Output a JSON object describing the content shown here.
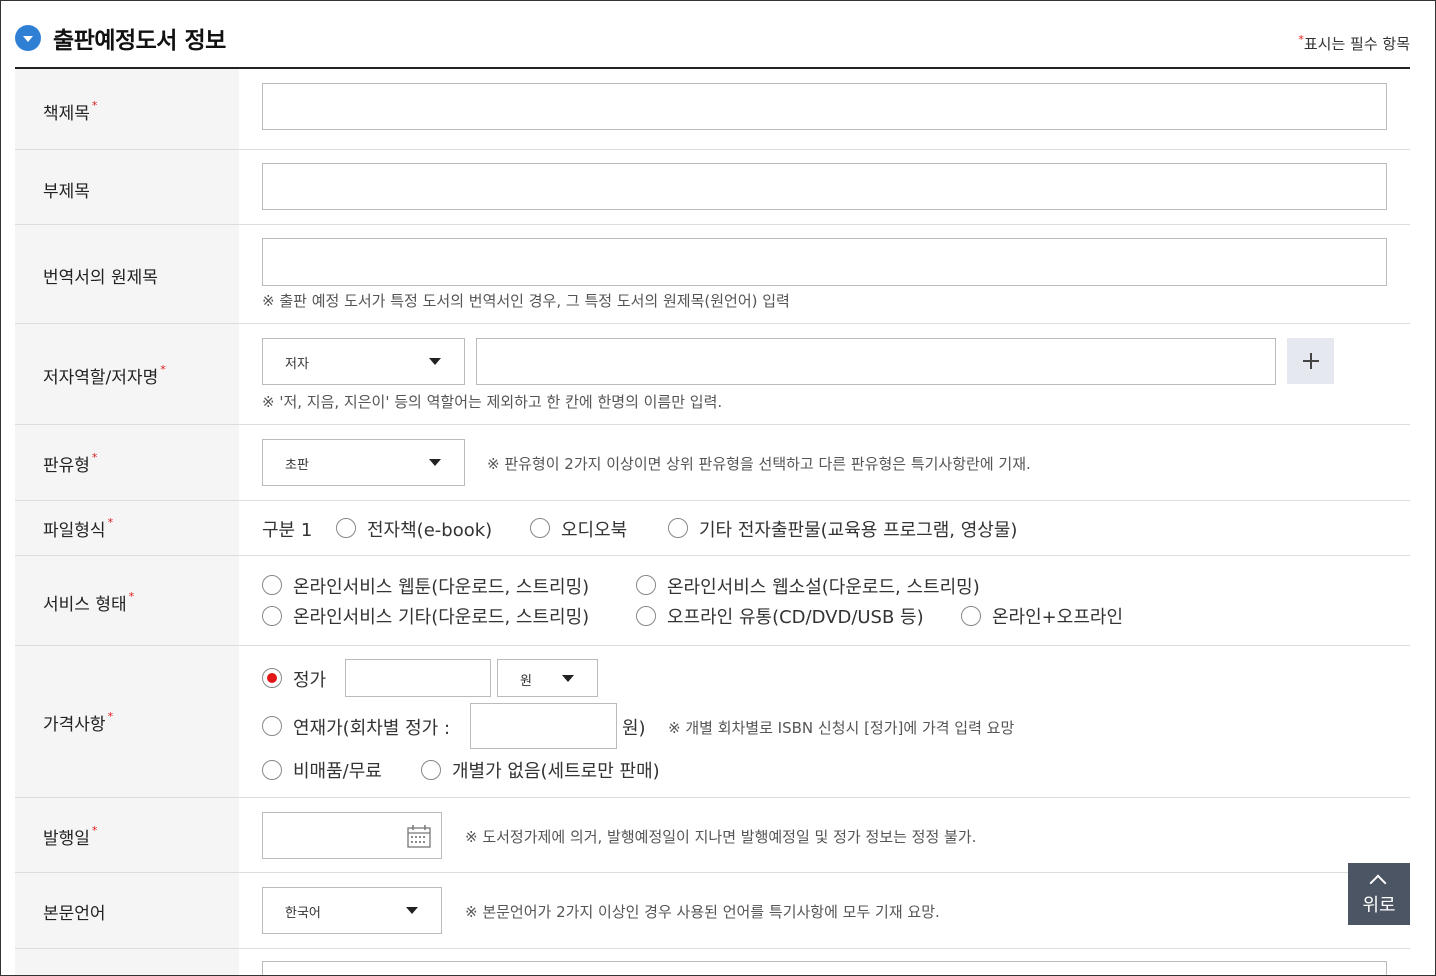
{
  "section": {
    "title": "출판예정도서 정보",
    "required_note": "표시는 필수 항목",
    "star": "*"
  },
  "fields": {
    "book_title": {
      "label": "책제목",
      "value": ""
    },
    "subtitle": {
      "label": "부제목",
      "value": ""
    },
    "original_title": {
      "label": "번역서의 원제목",
      "value": "",
      "note": "※ 출판 예정 도서가 특정 도서의 번역서인 경우, 그 특정 도서의 원제목(원언어) 입력"
    },
    "author": {
      "label": "저자역할/저자명",
      "role_selected": "저자",
      "value": "",
      "note": "※ '저, 지음, 지은이' 등의 역할어는 제외하고 한 칸에 한명의 이름만 입력."
    },
    "edition": {
      "label": "판유형",
      "selected": "초판",
      "note": "※ 판유형이 2가지 이상이면 상위 판유형을 선택하고 다른 판유형은 특기사항란에 기재."
    },
    "file_format": {
      "label": "파일형식",
      "group_label": "구분 1",
      "options": [
        "전자책(e-book)",
        "오디오북",
        "기타 전자출판물(교육용 프로그램, 영상물)"
      ]
    },
    "service_type": {
      "label": "서비스 형태",
      "options": [
        "온라인서비스 웹툰(다운로드, 스트리밍)",
        "온라인서비스 웹소설(다운로드, 스트리밍)",
        "온라인서비스 기타(다운로드, 스트리밍)",
        "오프라인 유통(CD/DVD/USB 등)",
        "온라인+오프라인"
      ]
    },
    "price": {
      "label": "가격사항",
      "list_price_label": "정가",
      "list_price_value": "",
      "currency_selected": "원",
      "serial_label": "연재가(회차별 정가 :",
      "serial_value": "",
      "serial_unit": "원)",
      "serial_note": "※ 개별 회차별로 ISBN 신청시 [정가]에 가격 입력 요망",
      "not_for_sale": "비매품/무료",
      "no_individual": "개별가 없음(세트로만 판매)"
    },
    "pub_date": {
      "label": "발행일",
      "value": "",
      "note": "※ 도서정가제에 의거, 발행예정일이 지나면 발행예정일 및 정가 정보는 정정 불가."
    },
    "language": {
      "label": "본문언어",
      "selected": "한국어",
      "note": "※ 본문언어가 2가지 이상인 경우 사용된 언어를 특기사항에 모두 기재 요망."
    }
  },
  "top_button": {
    "label": "위로"
  }
}
